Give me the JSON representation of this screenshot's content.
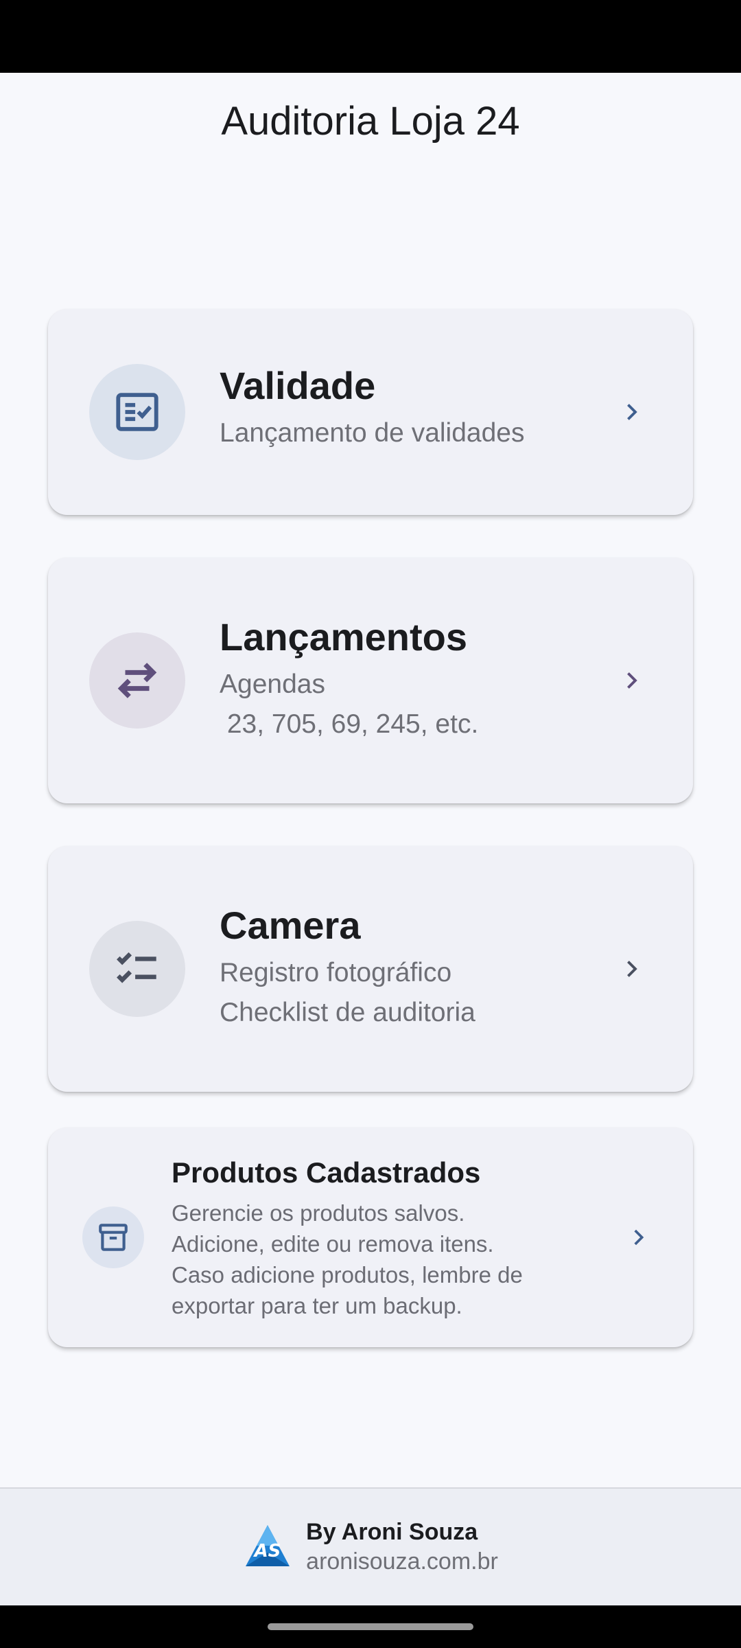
{
  "header": {
    "title": "Auditoria Loja 24"
  },
  "cards": [
    {
      "title": "Validade",
      "description": "Lançamento de validades",
      "icon": "fact-check-icon"
    },
    {
      "title": "Lançamentos",
      "description": "Agendas\n 23, 705, 69, 245, etc.",
      "icon": "swap-arrows-icon"
    },
    {
      "title": "Camera",
      "description": "Registro fotográfico\nChecklist de auditoria",
      "icon": "checklist-icon"
    },
    {
      "title": "Produtos Cadastrados",
      "description": "Gerencie os produtos salvos.\nAdicione, edite ou remova itens.\nCaso adicione produtos, lembre de\nexportar para ter um backup.",
      "icon": "archive-icon"
    }
  ],
  "footer": {
    "by": "By Aroni Souza",
    "site": "aronisouza.com.br",
    "logo_text": "AS"
  },
  "colors": {
    "accent": "#3f5f8f",
    "icon_purple": "#5f4f7c",
    "icon_gray": "#4a5060",
    "background": "#f7f8fc",
    "card": "#f0f1f7"
  }
}
